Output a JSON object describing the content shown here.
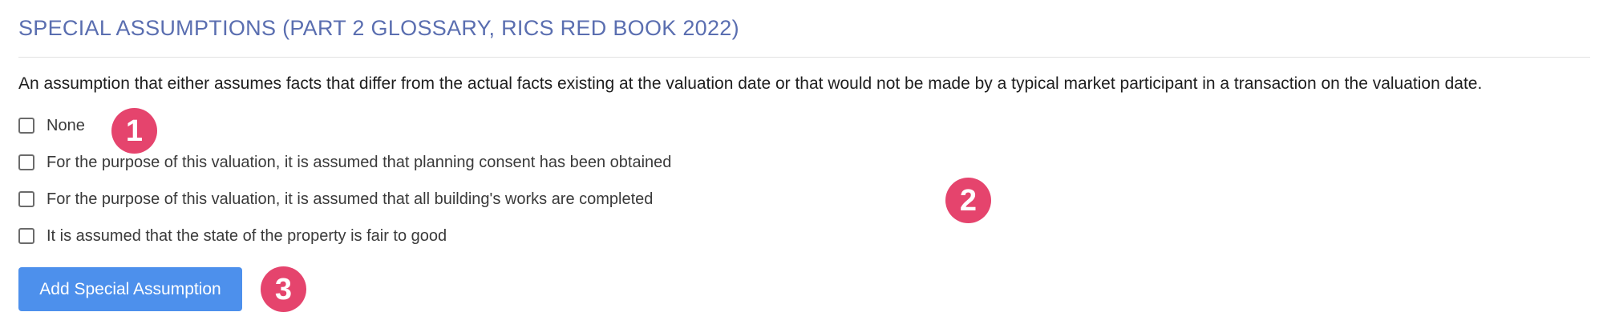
{
  "section": {
    "title": "SPECIAL ASSUMPTIONS (PART 2 GLOSSARY, RICS RED BOOK 2022)",
    "description": "An assumption that either assumes facts that differ from the actual facts existing at the valuation date or that would not be made by a typical market participant in a transaction on the valuation date."
  },
  "options": [
    {
      "label": "None",
      "checked": false
    },
    {
      "label": "For the purpose of this valuation, it is assumed that planning consent has been obtained",
      "checked": false
    },
    {
      "label": "For the purpose of this valuation, it is assumed that all building's works are completed",
      "checked": false
    },
    {
      "label": "It is assumed that the state of the property is fair to good",
      "checked": false
    }
  ],
  "add_button": {
    "label": "Add Special Assumption"
  },
  "markers": [
    "1",
    "2",
    "3"
  ],
  "colors": {
    "title": "#5a6eb0",
    "button": "#4d90ec",
    "marker": "#e5446d"
  }
}
